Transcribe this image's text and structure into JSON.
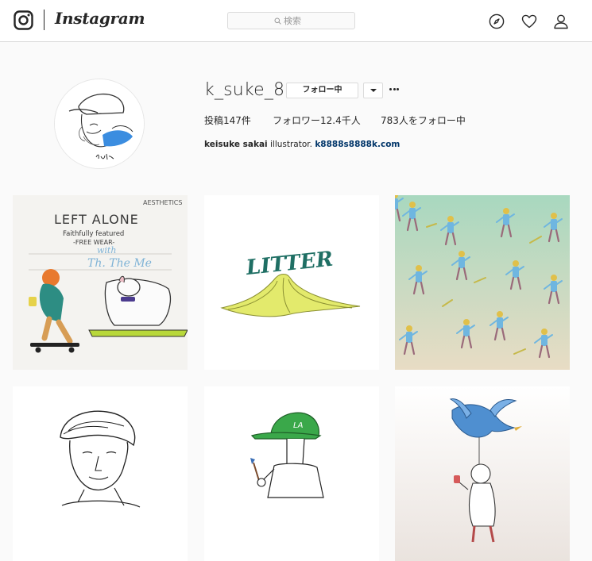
{
  "app": {
    "wordmark": "Instagram",
    "search_placeholder": "検索",
    "nav_icons": [
      "explore-icon",
      "heart-icon",
      "person-icon"
    ]
  },
  "profile": {
    "username": "k_suke_8",
    "follow_button": "フォロー中",
    "stats": {
      "posts": "投稿147件",
      "followers": "フォロワー12.4千人",
      "following": "783人をフォロー中"
    },
    "bio": {
      "full_name": "keisuke sakai",
      "text": "illustrator.",
      "link": "k8888s8888k.com"
    }
  },
  "posts": [
    {
      "id": "post-1",
      "kind": "pin badge card",
      "texts": {
        "corner": "AESTHETICS",
        "headline": "LEFT ALONE",
        "line1": "Faithfully featured",
        "line2": "-FREE WEAR-",
        "script": "with",
        "script2": "Th. The Me"
      }
    },
    {
      "id": "post-2",
      "kind": "banana peel illustration",
      "texts": {
        "word": "LITTER"
      }
    },
    {
      "id": "post-3",
      "kind": "pattern of skater figures",
      "texts": {}
    },
    {
      "id": "post-4",
      "kind": "man portrait sketch",
      "texts": {}
    },
    {
      "id": "post-5",
      "kind": "person in green cap",
      "texts": {
        "cap": "LA"
      }
    },
    {
      "id": "post-6",
      "kind": "blue bird and figure",
      "texts": {}
    }
  ],
  "colors": {
    "background": "#fafafa",
    "border": "#dbdbdb",
    "text": "#262626",
    "link": "#003569",
    "banana": "#dfe86a",
    "pattern_bg_top": "#b9d7c6",
    "cap_green": "#3aa84a",
    "bird_blue": "#4f8fd0"
  }
}
